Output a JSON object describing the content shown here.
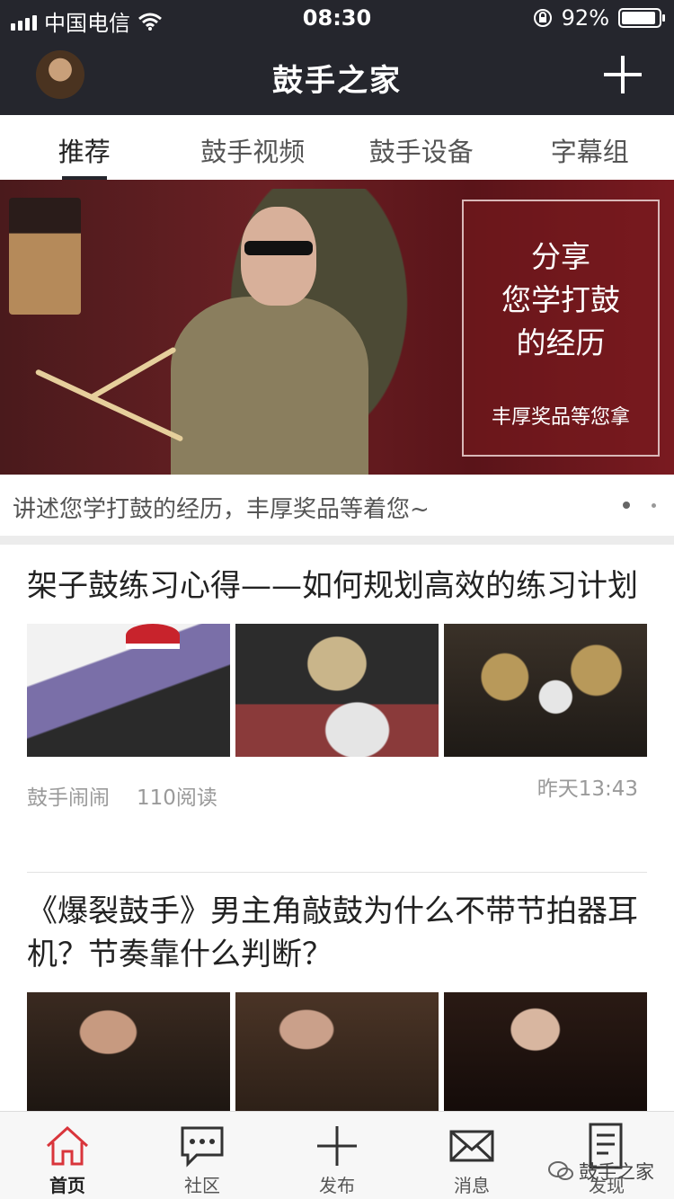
{
  "status_bar": {
    "carrier": "中国电信",
    "time": "08:30",
    "battery": "92%",
    "battery_level": 0.92
  },
  "nav": {
    "title": "鼓手之家"
  },
  "tabs": [
    {
      "label": "推荐",
      "active": true
    },
    {
      "label": "鼓手视频",
      "active": false
    },
    {
      "label": "鼓手设备",
      "active": false
    },
    {
      "label": "字幕组",
      "active": false
    }
  ],
  "banner": {
    "box_line1": "分享",
    "box_line2": "您学打鼓",
    "box_line3": "的经历",
    "box_small": "丰厚奖品等您拿",
    "caption": "讲述您学打鼓的经历，丰厚奖品等着您~"
  },
  "articles": [
    {
      "title": "架子鼓练习心得——如何规划高效的练习计划",
      "author": "鼓手闹闹",
      "reads": "110阅读",
      "time": "昨天13:43"
    },
    {
      "title": "《爆裂鼓手》男主角敲鼓为什么不带节拍器耳机？节奏靠什么判断？"
    }
  ],
  "tab_bar": [
    {
      "label": "首页",
      "icon": "home-icon",
      "active": true
    },
    {
      "label": "社区",
      "icon": "chat-icon",
      "active": false
    },
    {
      "label": "发布",
      "icon": "plus-icon",
      "active": false
    },
    {
      "label": "消息",
      "icon": "mail-icon",
      "active": false
    },
    {
      "label": "发现",
      "icon": "document-icon",
      "active": false
    }
  ],
  "watermark": "鼓手之家",
  "colors": {
    "header": "#25262d",
    "accent_red": "#d9353b"
  }
}
